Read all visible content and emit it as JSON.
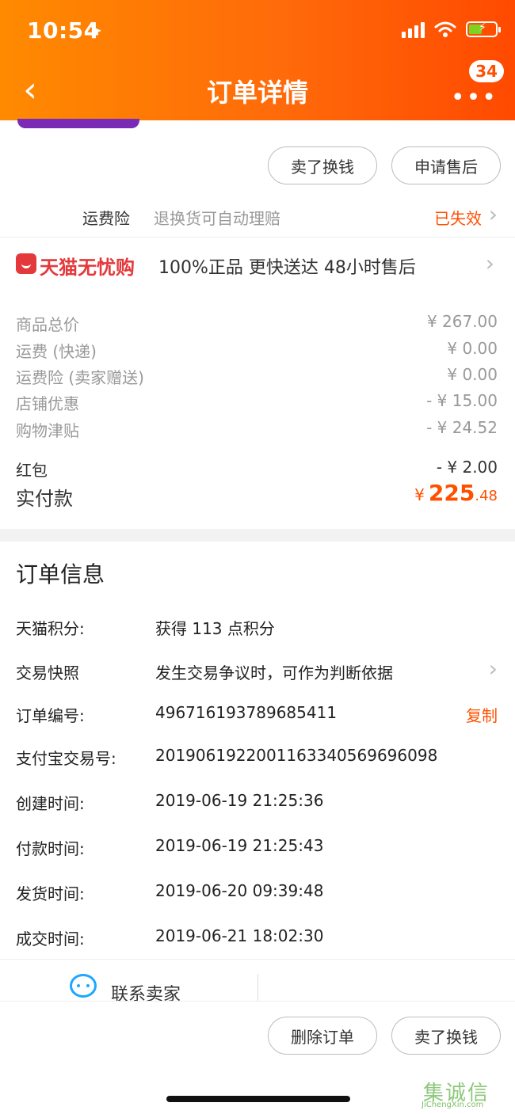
{
  "status_bar": {
    "time": "10:54",
    "location_glyph": "➤"
  },
  "header": {
    "title": "订单详情",
    "back_glyph": "‹",
    "more_glyph": "•••",
    "badge": "34"
  },
  "actions_top": {
    "sell": "卖了换钱",
    "after_sale": "申请售后"
  },
  "freight_insurance": {
    "label": "运费险",
    "desc": "退换货可自动理赔",
    "status": "已失效"
  },
  "tmall": {
    "brand": "天猫无忧购",
    "tags": "100%正品  更快送达  48小时售后"
  },
  "price": {
    "rows": [
      {
        "label": "商品总价",
        "value": "¥ 267.00"
      },
      {
        "label": "运费 (快递)",
        "value": "¥ 0.00"
      },
      {
        "label": "运费险 (卖家赠送)",
        "value": "¥ 0.00"
      },
      {
        "label": "店铺优惠",
        "value": "- ¥ 15.00"
      },
      {
        "label": "购物津贴",
        "value": "- ¥ 24.52"
      }
    ],
    "hongbao": {
      "label": "红包",
      "value": "- ¥ 2.00"
    },
    "paid": {
      "label": "实付款",
      "currency": "¥",
      "integer": "225",
      "decimal": ".48"
    }
  },
  "order_info": {
    "title": "订单信息",
    "points": {
      "label": "天猫积分:",
      "value": "获得 113 点积分"
    },
    "snapshot": {
      "label": "交易快照",
      "value": "发生交易争议时，可作为判断依据"
    },
    "order_no": {
      "label": "订单编号:",
      "value": "496716193789685411",
      "action": "复制"
    },
    "alipay_no": {
      "label": "支付宝交易号:",
      "value": "2019061922001163340569696098"
    },
    "created": {
      "label": "创建时间:",
      "value": "2019-06-19 21:25:36"
    },
    "paid_time": {
      "label": "付款时间:",
      "value": "2019-06-19 21:25:43"
    },
    "shipped": {
      "label": "发货时间:",
      "value": "2019-06-20 09:39:48"
    },
    "closed": {
      "label": "成交时间:",
      "value": "2019-06-21 18:02:30"
    }
  },
  "contact": {
    "label": "联系卖家"
  },
  "bottom_actions": {
    "delete": "删除订单",
    "sell": "卖了换钱"
  },
  "watermark": {
    "text": "集诚信",
    "url": "JiChengXin.com"
  },
  "colors": {
    "accent": "#ff5000",
    "tmall_red": "#e4393c",
    "header_gradient_start": "#ff8a00",
    "header_gradient_end": "#ff4a00"
  },
  "icons": {
    "back": "chevron-left-icon",
    "more": "more-dots-icon",
    "chevron": "chevron-right-icon",
    "seller": "seller-chat-icon",
    "location": "location-arrow-icon",
    "wifi": "wifi-icon",
    "signal": "signal-icon",
    "battery": "battery-icon"
  }
}
